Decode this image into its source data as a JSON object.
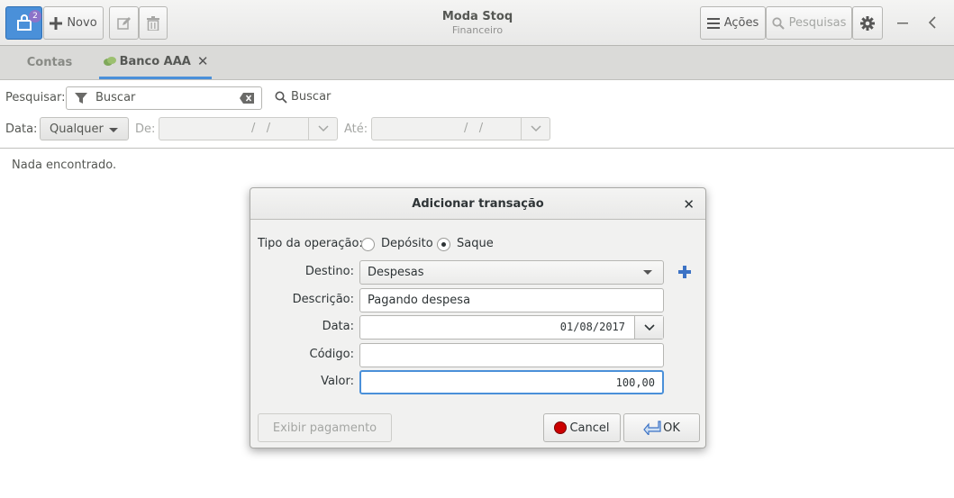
{
  "app": {
    "title": "Moda Stoq",
    "subtitle": "Financeiro",
    "notification_count": "2"
  },
  "toolbar": {
    "new_label": "Novo",
    "actions_label": "Ações",
    "search_label": "Pesquisas"
  },
  "tabs": [
    {
      "label": "Contas"
    },
    {
      "label": "Banco AAA"
    }
  ],
  "search": {
    "label": "Pesquisar:",
    "placeholder": "Buscar",
    "button_label": "Buscar"
  },
  "filter": {
    "date_label": "Data:",
    "date_option": "Qualquer",
    "from_label": "De:",
    "from_value": "/   /",
    "to_label": "Até:",
    "to_value": "/   /"
  },
  "results": {
    "empty_text": "Nada encontrado."
  },
  "dialog": {
    "title": "Adicionar transação",
    "operation_label": "Tipo da operação:",
    "deposit_label": "Depósito",
    "withdraw_label": "Saque",
    "selected_operation": "Saque",
    "destination_label": "Destino:",
    "destination_value": "Despesas",
    "description_label": "Descrição:",
    "description_value": "Pagando despesa",
    "date_label": "Data:",
    "date_value": "01/08/2017",
    "code_label": "Código:",
    "code_value": "",
    "amount_label": "Valor:",
    "amount_value": "100,00",
    "show_payment_label": "Exibir pagamento",
    "cancel_label": "Cancel",
    "ok_label": "OK"
  },
  "colors": {
    "accent": "#4a90d9",
    "cancel_icon": "#cc0000"
  }
}
